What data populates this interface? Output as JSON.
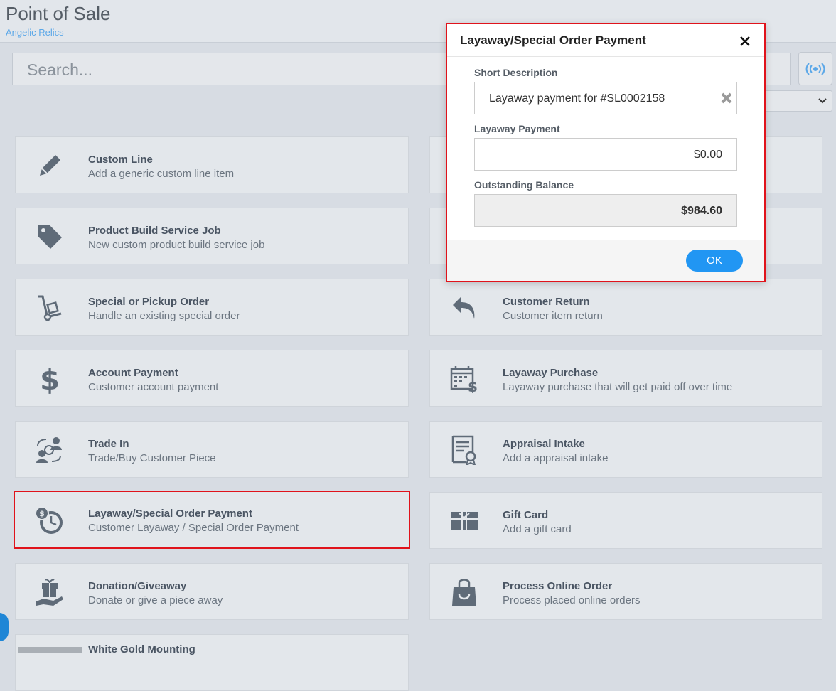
{
  "header": {
    "title": "Point of Sale",
    "subtitle": "Angelic Relics"
  },
  "search": {
    "placeholder": "Search..."
  },
  "tiles": [
    {
      "title": "Custom Line",
      "subtitle": "Add a generic custom line item",
      "icon": "pencil-icon"
    },
    {
      "title": "Product Build Service Job",
      "subtitle": "New custom product build service job",
      "icon": "tag-icon"
    },
    {
      "title": "Special or Pickup Order",
      "subtitle": "Handle an existing special order",
      "icon": "hand-truck-icon"
    },
    {
      "title": "Customer Return",
      "subtitle": "Customer item return",
      "icon": "return-arrow-icon"
    },
    {
      "title": "Account Payment",
      "subtitle": "Customer account payment",
      "icon": "dollar-icon"
    },
    {
      "title": "Layaway Purchase",
      "subtitle": "Layaway purchase that will get paid off over time",
      "icon": "calendar-dollar-icon"
    },
    {
      "title": "Trade In",
      "subtitle": "Trade/Buy Customer Piece",
      "icon": "exchange-users-icon"
    },
    {
      "title": "Appraisal Intake",
      "subtitle": "Add a appraisal intake",
      "icon": "certificate-icon"
    },
    {
      "title": "Layaway/Special Order Payment",
      "subtitle": "Customer Layaway / Special Order Payment",
      "icon": "coin-clock-icon"
    },
    {
      "title": "Gift Card",
      "subtitle": "Add a gift card",
      "icon": "gift-card-icon"
    },
    {
      "title": "Donation/Giveaway",
      "subtitle": "Donate or give a piece away",
      "icon": "gift-hand-icon"
    },
    {
      "title": "Process Online Order",
      "subtitle": "Process placed online orders",
      "icon": "shopping-bag-icon"
    },
    {
      "title": "White Gold Mounting",
      "subtitle": "",
      "icon": "product-thumbnail"
    }
  ],
  "modal": {
    "title": "Layaway/Special Order Payment",
    "short_description_label": "Short Description",
    "short_description_value": "Layaway payment for #SL0002158",
    "layaway_payment_label": "Layaway Payment",
    "layaway_payment_value": "$0.00",
    "outstanding_balance_label": "Outstanding Balance",
    "outstanding_balance_value": "$984.60",
    "ok_label": "OK"
  },
  "colors": {
    "highlight": "#e0131b",
    "accent": "#2196f3",
    "link": "#5aa7e8"
  }
}
